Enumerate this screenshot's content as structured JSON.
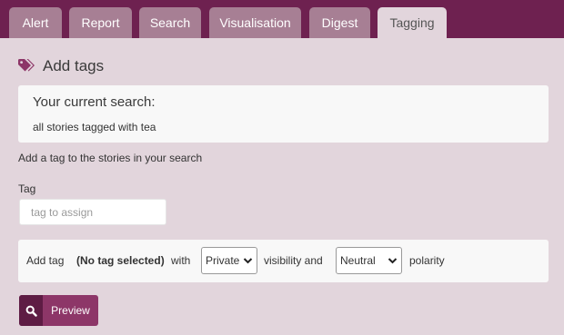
{
  "tabs": [
    {
      "label": "Alert",
      "active": false
    },
    {
      "label": "Report",
      "active": false
    },
    {
      "label": "Search",
      "active": false
    },
    {
      "label": "Visualisation",
      "active": false
    },
    {
      "label": "Digest",
      "active": false
    },
    {
      "label": "Tagging",
      "active": true
    }
  ],
  "colors": {
    "tab_bar": "#6e2150",
    "tab_inactive": "#a77f94",
    "page_background": "#e2d5dc",
    "accent": "#8d3668",
    "accent_dark": "#5e1c44"
  },
  "heading": {
    "icon": "tags-icon",
    "title": "Add tags"
  },
  "current_search": {
    "title": "Your current search:",
    "query": "all stories tagged with tea"
  },
  "instruction": "Add a tag to the stories in your search",
  "tag_field": {
    "label": "Tag",
    "placeholder": "tag to assign",
    "value": ""
  },
  "options": {
    "prefix": "Add tag",
    "selected_tag": "(No tag selected)",
    "with_text": "with",
    "visibility_value": "Private",
    "visibility_suffix": "visibility and",
    "polarity_value": "Neutral",
    "polarity_suffix": "polarity"
  },
  "preview_button": {
    "icon": "search-icon",
    "label": "Preview"
  }
}
